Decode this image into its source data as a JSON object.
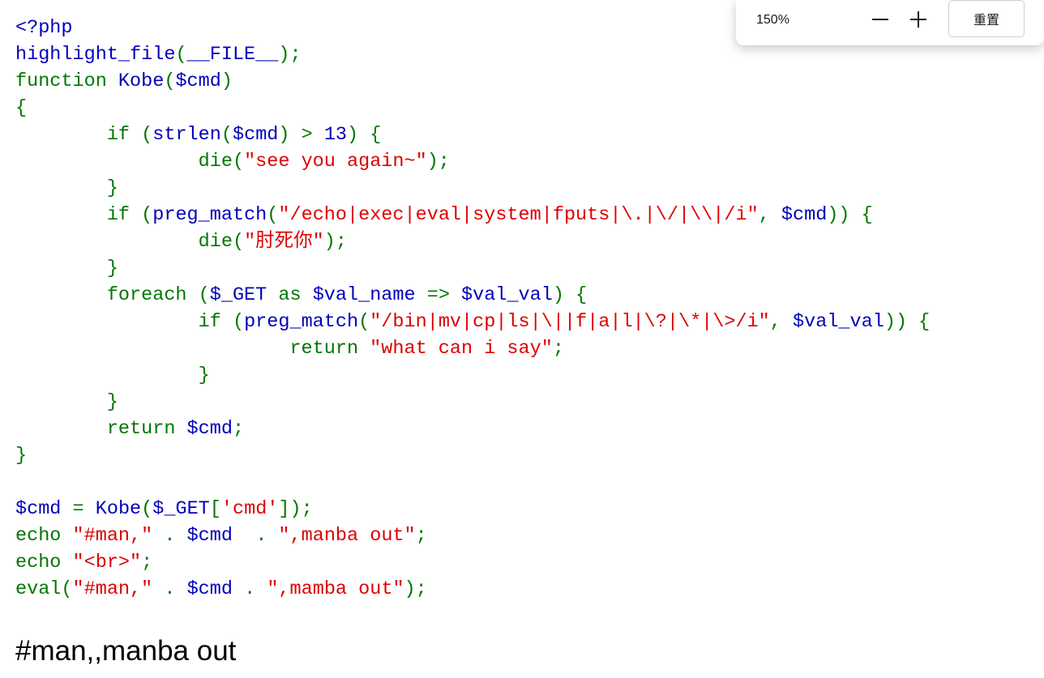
{
  "source_code": {
    "lines": [
      [
        {
          "t": "<?php",
          "c": "d"
        }
      ],
      [
        {
          "t": "highlight_file",
          "c": "d"
        },
        {
          "t": "(",
          "c": "k"
        },
        {
          "t": "__FILE__",
          "c": "d"
        },
        {
          "t": ");",
          "c": "k"
        }
      ],
      [
        {
          "t": "function ",
          "c": "k"
        },
        {
          "t": "Kobe",
          "c": "d"
        },
        {
          "t": "(",
          "c": "k"
        },
        {
          "t": "$cmd",
          "c": "d"
        },
        {
          "t": ")",
          "c": "k"
        }
      ],
      [
        {
          "t": "{",
          "c": "k"
        }
      ],
      [
        {
          "t": "        if ",
          "c": "k"
        },
        {
          "t": "(",
          "c": "k"
        },
        {
          "t": "strlen",
          "c": "d"
        },
        {
          "t": "(",
          "c": "k"
        },
        {
          "t": "$cmd",
          "c": "d"
        },
        {
          "t": ") > ",
          "c": "k"
        },
        {
          "t": "13",
          "c": "d"
        },
        {
          "t": ") {",
          "c": "k"
        }
      ],
      [
        {
          "t": "                die",
          "c": "k"
        },
        {
          "t": "(",
          "c": "k"
        },
        {
          "t": "\"see you again~\"",
          "c": "s"
        },
        {
          "t": ");",
          "c": "k"
        }
      ],
      [
        {
          "t": "        }",
          "c": "k"
        }
      ],
      [
        {
          "t": "        if ",
          "c": "k"
        },
        {
          "t": "(",
          "c": "k"
        },
        {
          "t": "preg_match",
          "c": "d"
        },
        {
          "t": "(",
          "c": "k"
        },
        {
          "t": "\"/echo|exec|eval|system|fputs|\\.|\\/|\\\\|/i\"",
          "c": "s"
        },
        {
          "t": ", ",
          "c": "k"
        },
        {
          "t": "$cmd",
          "c": "d"
        },
        {
          "t": ")) {",
          "c": "k"
        }
      ],
      [
        {
          "t": "                die",
          "c": "k"
        },
        {
          "t": "(",
          "c": "k"
        },
        {
          "t": "\"肘死你\"",
          "c": "s"
        },
        {
          "t": ");",
          "c": "k"
        }
      ],
      [
        {
          "t": "        }",
          "c": "k"
        }
      ],
      [
        {
          "t": "        foreach ",
          "c": "k"
        },
        {
          "t": "(",
          "c": "k"
        },
        {
          "t": "$_GET ",
          "c": "d"
        },
        {
          "t": "as ",
          "c": "k"
        },
        {
          "t": "$val_name ",
          "c": "d"
        },
        {
          "t": "=> ",
          "c": "k"
        },
        {
          "t": "$val_val",
          "c": "d"
        },
        {
          "t": ") {",
          "c": "k"
        }
      ],
      [
        {
          "t": "                if ",
          "c": "k"
        },
        {
          "t": "(",
          "c": "k"
        },
        {
          "t": "preg_match",
          "c": "d"
        },
        {
          "t": "(",
          "c": "k"
        },
        {
          "t": "\"/bin|mv|cp|ls|\\||f|a|l|\\?|\\*|\\>/i\"",
          "c": "s"
        },
        {
          "t": ", ",
          "c": "k"
        },
        {
          "t": "$val_val",
          "c": "d"
        },
        {
          "t": ")) {",
          "c": "k"
        }
      ],
      [
        {
          "t": "                        return ",
          "c": "k"
        },
        {
          "t": "\"what can i say\"",
          "c": "s"
        },
        {
          "t": ";",
          "c": "k"
        }
      ],
      [
        {
          "t": "                }",
          "c": "k"
        }
      ],
      [
        {
          "t": "        }",
          "c": "k"
        }
      ],
      [
        {
          "t": "        return ",
          "c": "k"
        },
        {
          "t": "$cmd",
          "c": "d"
        },
        {
          "t": ";",
          "c": "k"
        }
      ],
      [
        {
          "t": "}",
          "c": "k"
        }
      ],
      [],
      [
        {
          "t": "$cmd ",
          "c": "d"
        },
        {
          "t": "= ",
          "c": "k"
        },
        {
          "t": "Kobe",
          "c": "d"
        },
        {
          "t": "(",
          "c": "k"
        },
        {
          "t": "$_GET",
          "c": "d"
        },
        {
          "t": "[",
          "c": "k"
        },
        {
          "t": "'cmd'",
          "c": "s"
        },
        {
          "t": "]);",
          "c": "k"
        }
      ],
      [
        {
          "t": "echo ",
          "c": "k"
        },
        {
          "t": "\"#man,\" ",
          "c": "s"
        },
        {
          "t": ". ",
          "c": "k"
        },
        {
          "t": "$cmd  ",
          "c": "d"
        },
        {
          "t": ". ",
          "c": "k"
        },
        {
          "t": "\",manba out\"",
          "c": "s"
        },
        {
          "t": ";",
          "c": "k"
        }
      ],
      [
        {
          "t": "echo ",
          "c": "k"
        },
        {
          "t": "\"<br>\"",
          "c": "s"
        },
        {
          "t": ";",
          "c": "k"
        }
      ],
      [
        {
          "t": "eval",
          "c": "k"
        },
        {
          "t": "(",
          "c": "k"
        },
        {
          "t": "\"#man,\" ",
          "c": "s"
        },
        {
          "t": ". ",
          "c": "k"
        },
        {
          "t": "$cmd ",
          "c": "d"
        },
        {
          "t": ". ",
          "c": "k"
        },
        {
          "t": "\",mamba out\"",
          "c": "s"
        },
        {
          "t": ");",
          "c": "k"
        }
      ]
    ]
  },
  "page_output": "#man,,manba out",
  "zoom_popup": {
    "zoom_level": "150%",
    "zoom_out_icon": "minus-icon",
    "zoom_in_icon": "plus-icon",
    "reset_label": "重置"
  },
  "colors": {
    "html_color": "#0000bb",
    "keyword": "#007700",
    "string": "#dd0000",
    "output_text": "#000000"
  }
}
